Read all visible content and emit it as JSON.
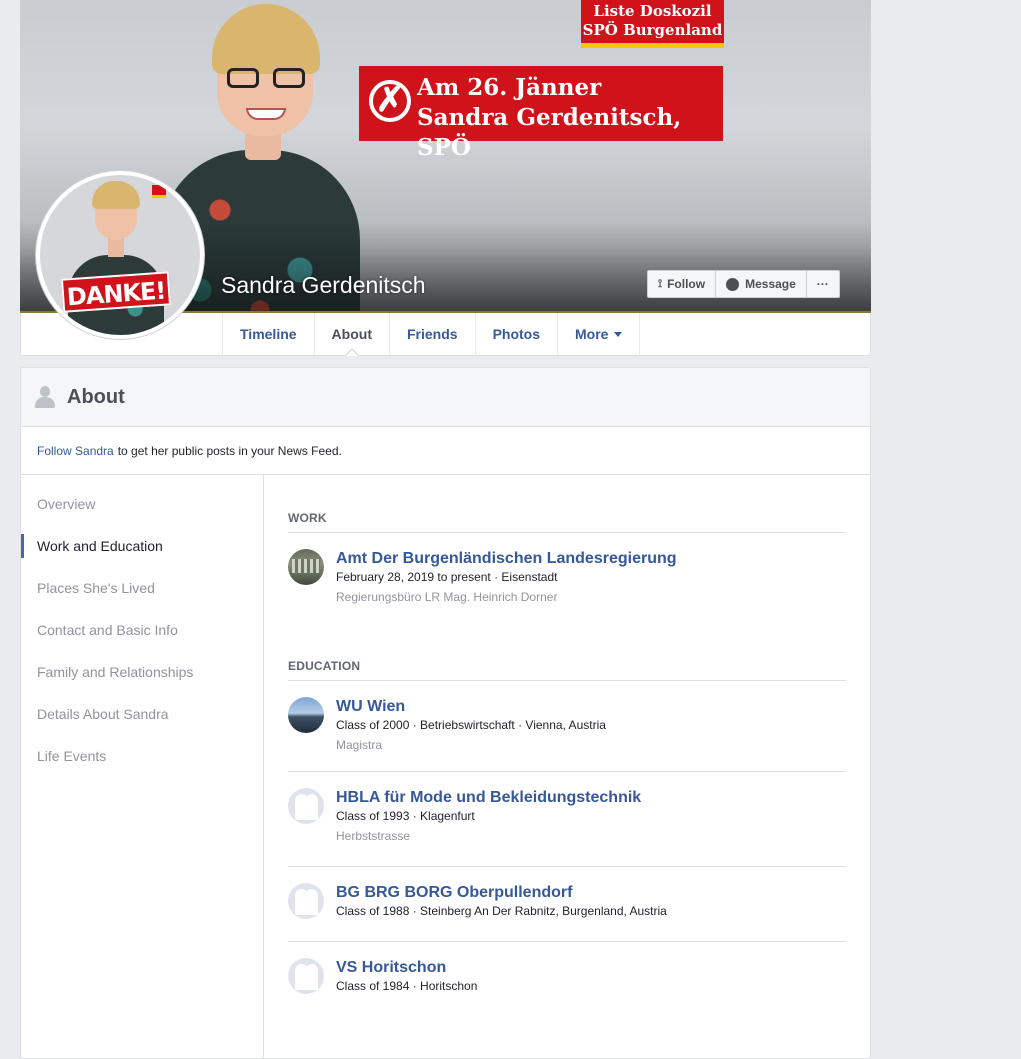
{
  "cover": {
    "banner_top_line1": "Liste Doskozil",
    "banner_top_line2": "SPÖ Burgenland",
    "banner_main_line1": "Am 26. Jänner",
    "banner_main_line2": "Sandra Gerdenitsch, SPÖ",
    "profile_name": "Sandra Gerdenitsch",
    "avatar_badge": "DANKE!",
    "actions": {
      "follow": "Follow",
      "message": "Message",
      "more": "···"
    }
  },
  "tabs": [
    {
      "label": "Timeline"
    },
    {
      "label": "About"
    },
    {
      "label": "Friends"
    },
    {
      "label": "Photos"
    },
    {
      "label": "More"
    }
  ],
  "about": {
    "title": "About",
    "follow_link": "Follow Sandra",
    "follow_text": "to get her public posts in your News Feed.",
    "nav": [
      "Overview",
      "Work and Education",
      "Places She's Lived",
      "Contact and Basic Info",
      "Family and Relationships",
      "Details About Sandra",
      "Life Events"
    ],
    "work_heading": "WORK",
    "work": [
      {
        "title": "Amt Der Burgenländischen Landesregierung",
        "sub": "February 28, 2019 to present · Eisenstadt",
        "extra": "Regierungsbüro LR Mag. Heinrich Dorner"
      }
    ],
    "education_heading": "EDUCATION",
    "education": [
      {
        "title": "WU Wien",
        "sub": "Class of 2000 · Betriebswirtschaft · Vienna, Austria",
        "extra": "Magistra"
      },
      {
        "title": "HBLA für Mode und Bekleidungstechnik",
        "sub": "Class of 1993 · Klagenfurt",
        "extra": "Herbststrasse"
      },
      {
        "title": "BG BRG BORG Oberpullendorf",
        "sub": "Class of 1988 · Steinberg An Der Rabnitz, Burgenland, Austria"
      },
      {
        "title": "VS Horitschon",
        "sub": "Class of 1984 · Horitschon"
      }
    ]
  },
  "colors": {
    "link": "#365899",
    "spo_red": "#d0121b",
    "spo_yellow": "#f7c600",
    "page_bg": "#e9ebee"
  }
}
